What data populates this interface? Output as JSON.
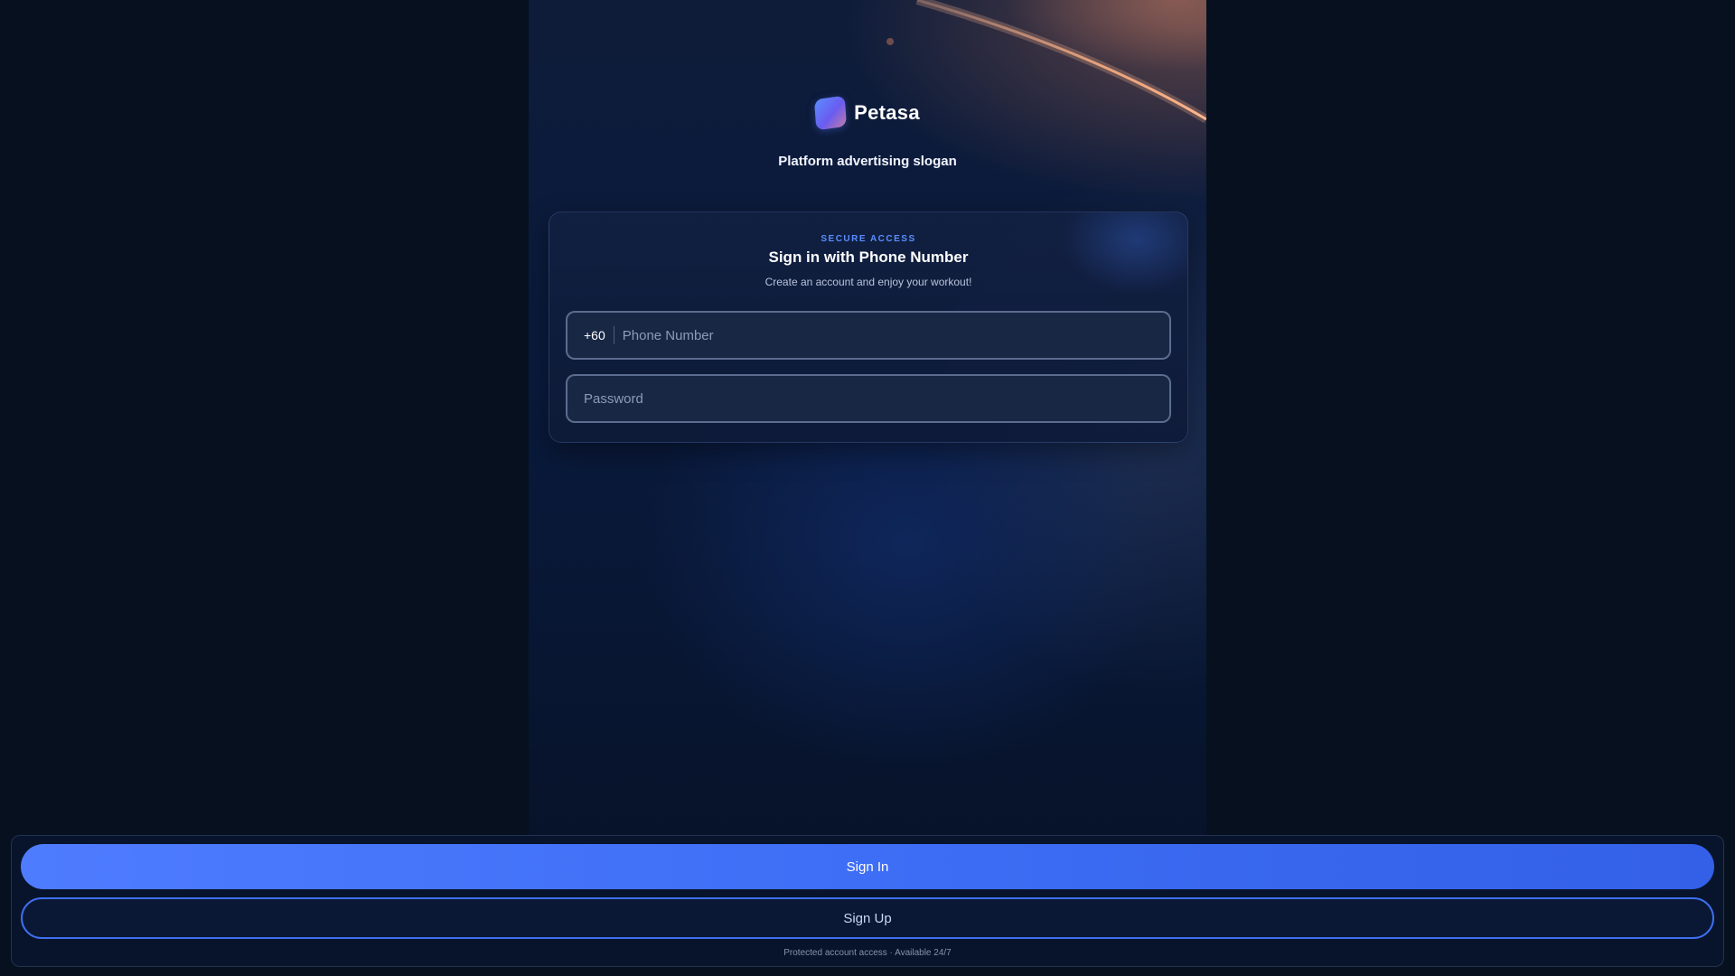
{
  "brand": {
    "logo_icon": "petasa-logo-icon",
    "name": "Petasa",
    "slogan": "Platform advertising slogan"
  },
  "login_card": {
    "eyebrow": "SECURE ACCESS",
    "title": "Sign in with Phone Number",
    "subtitle": "Create an account and enjoy your workout!",
    "phone": {
      "country_code": "+60",
      "placeholder": "Phone Number",
      "value": ""
    },
    "password": {
      "placeholder": "Password",
      "value": ""
    }
  },
  "actions": {
    "sign_in_label": "Sign In",
    "sign_up_label": "Sign Up",
    "footnote": "Protected account access · Available 24/7"
  },
  "colors": {
    "accent": "#4f7cff",
    "eyebrow": "#5a8dff",
    "background": "#06101f"
  }
}
